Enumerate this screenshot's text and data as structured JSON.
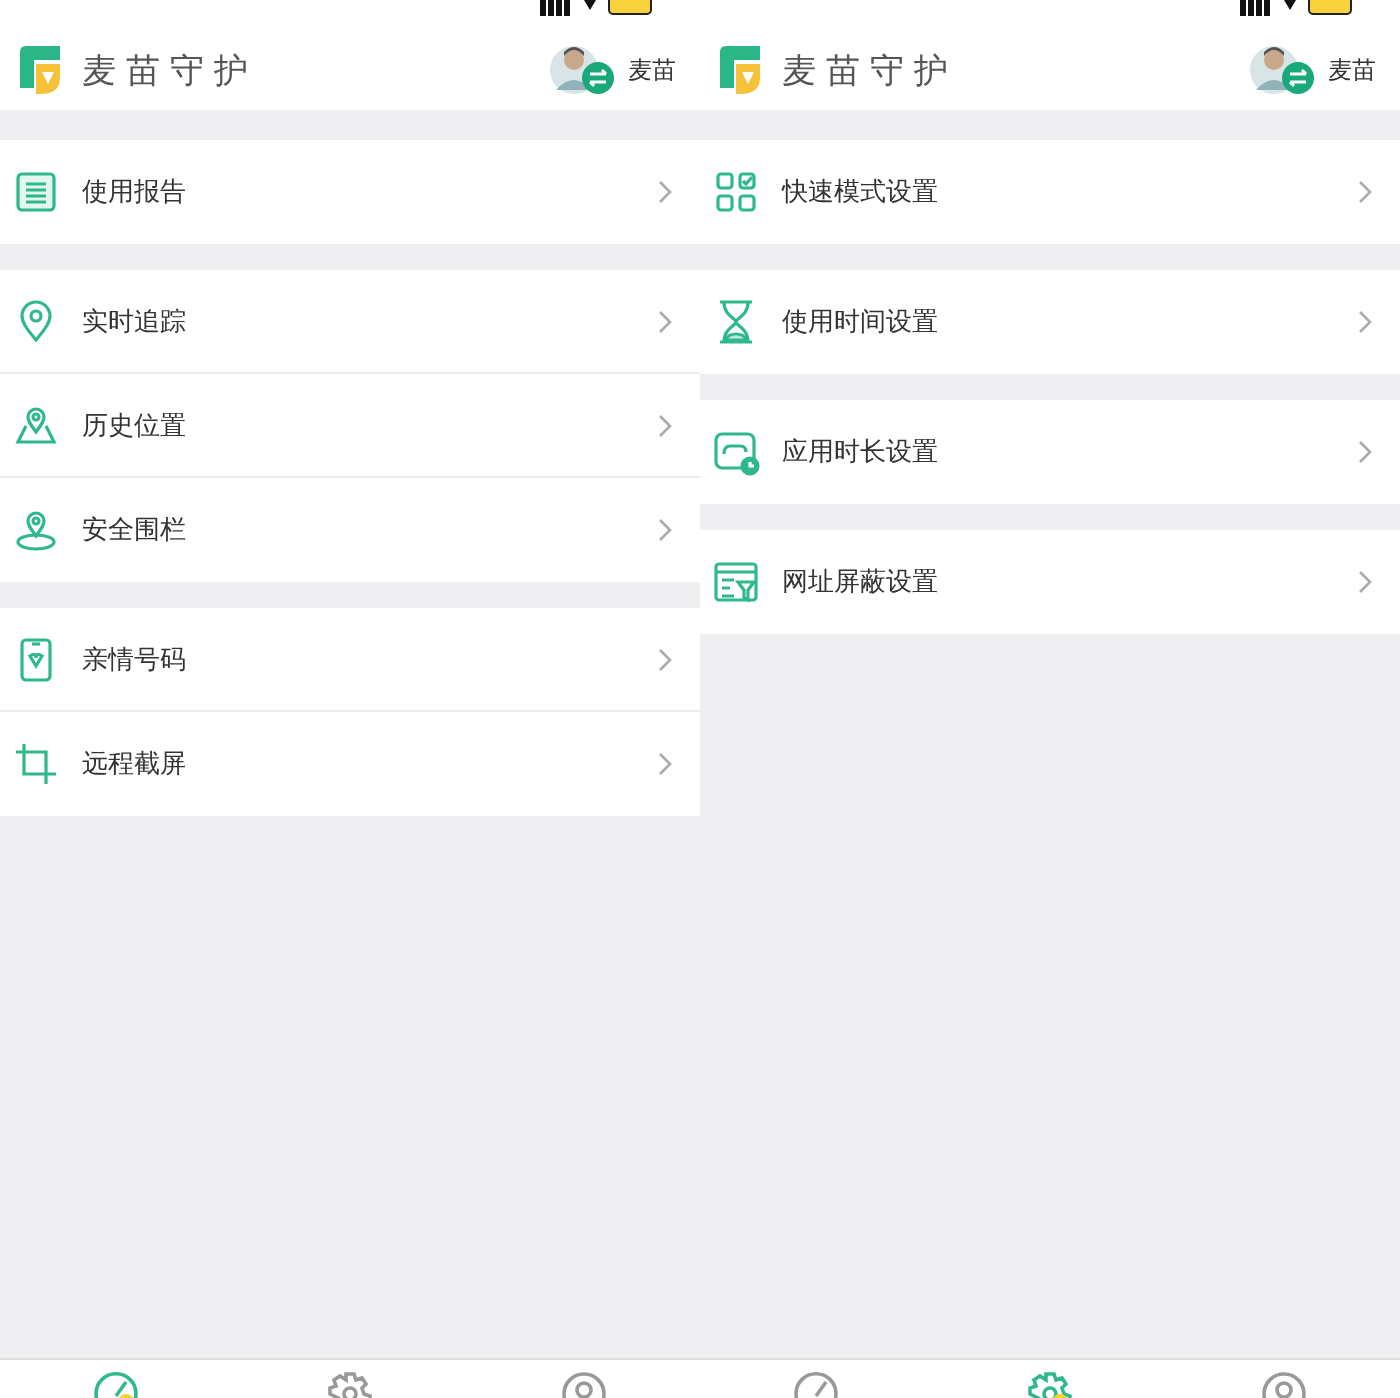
{
  "screens": [
    {
      "header": {
        "app_title": "麦苗守护",
        "user_name": "麦苗"
      },
      "groups": [
        [
          {
            "label": "使用报告"
          }
        ],
        [
          {
            "label": "实时追踪"
          },
          {
            "label": "历史位置"
          },
          {
            "label": "安全围栏"
          }
        ],
        [
          {
            "label": "亲情号码"
          },
          {
            "label": "远程截屏"
          }
        ]
      ],
      "tabs": [
        {
          "selected": true
        },
        {
          "selected": false
        },
        {
          "selected": false
        }
      ]
    },
    {
      "header": {
        "app_title": "麦苗守护",
        "user_name": "麦苗"
      },
      "groups": [
        [
          {
            "label": "快速模式设置"
          }
        ],
        [
          {
            "label": "使用时间设置"
          }
        ],
        [
          {
            "label": "应用时长设置"
          }
        ],
        [
          {
            "label": "网址屏蔽设置"
          }
        ]
      ],
      "tabs": [
        {
          "selected": false
        },
        {
          "selected": true
        },
        {
          "selected": false
        }
      ]
    }
  ]
}
